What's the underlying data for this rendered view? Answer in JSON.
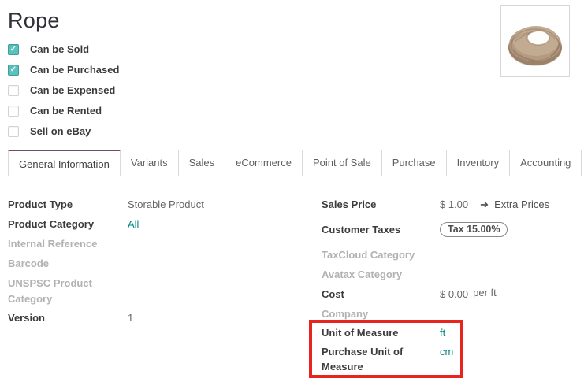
{
  "header": {
    "title": "Rope",
    "checkboxes": [
      {
        "label": "Can be Sold",
        "checked": true
      },
      {
        "label": "Can be Purchased",
        "checked": true
      },
      {
        "label": "Can be Expensed",
        "checked": false
      },
      {
        "label": "Can be Rented",
        "checked": false
      },
      {
        "label": "Sell on eBay",
        "checked": false
      }
    ]
  },
  "tabs": [
    {
      "label": "General Information",
      "active": true
    },
    {
      "label": "Variants"
    },
    {
      "label": "Sales"
    },
    {
      "label": "eCommerce"
    },
    {
      "label": "Point of Sale"
    },
    {
      "label": "Purchase"
    },
    {
      "label": "Inventory"
    },
    {
      "label": "Accounting"
    }
  ],
  "form": {
    "product_type": {
      "label": "Product Type",
      "value": "Storable Product"
    },
    "product_category": {
      "label": "Product Category",
      "value": "All"
    },
    "internal_reference": {
      "label": "Internal Reference",
      "value": ""
    },
    "barcode": {
      "label": "Barcode",
      "value": ""
    },
    "unspsc": {
      "label": "UNSPSC Product Category",
      "value": ""
    },
    "version": {
      "label": "Version",
      "value": "1"
    },
    "sales_price": {
      "label": "Sales Price",
      "value": "$ 1.00",
      "extra_link": "Extra Prices"
    },
    "customer_taxes": {
      "label": "Customer Taxes",
      "badge": "Tax 15.00%"
    },
    "taxcloud_category": {
      "label": "TaxCloud Category",
      "value": ""
    },
    "avatax_category": {
      "label": "Avatax Category",
      "value": ""
    },
    "cost": {
      "label": "Cost",
      "value": "$ 0.00",
      "suffix": "per ft"
    },
    "company": {
      "label": "Company",
      "value": ""
    },
    "unit_of_measure": {
      "label": "Unit of Measure",
      "value": "ft"
    },
    "purchase_unit_of_measure": {
      "label": "Purchase Unit of Measure",
      "value": "cm"
    }
  },
  "icons": {
    "checkmark": "✓",
    "extra_prices_arrow": "➔"
  },
  "colors": {
    "link_teal": "#008784",
    "checkbox_teal": "#5ac2bc",
    "active_tab_accent": "#714b67",
    "highlight_red": "#e8241f"
  }
}
